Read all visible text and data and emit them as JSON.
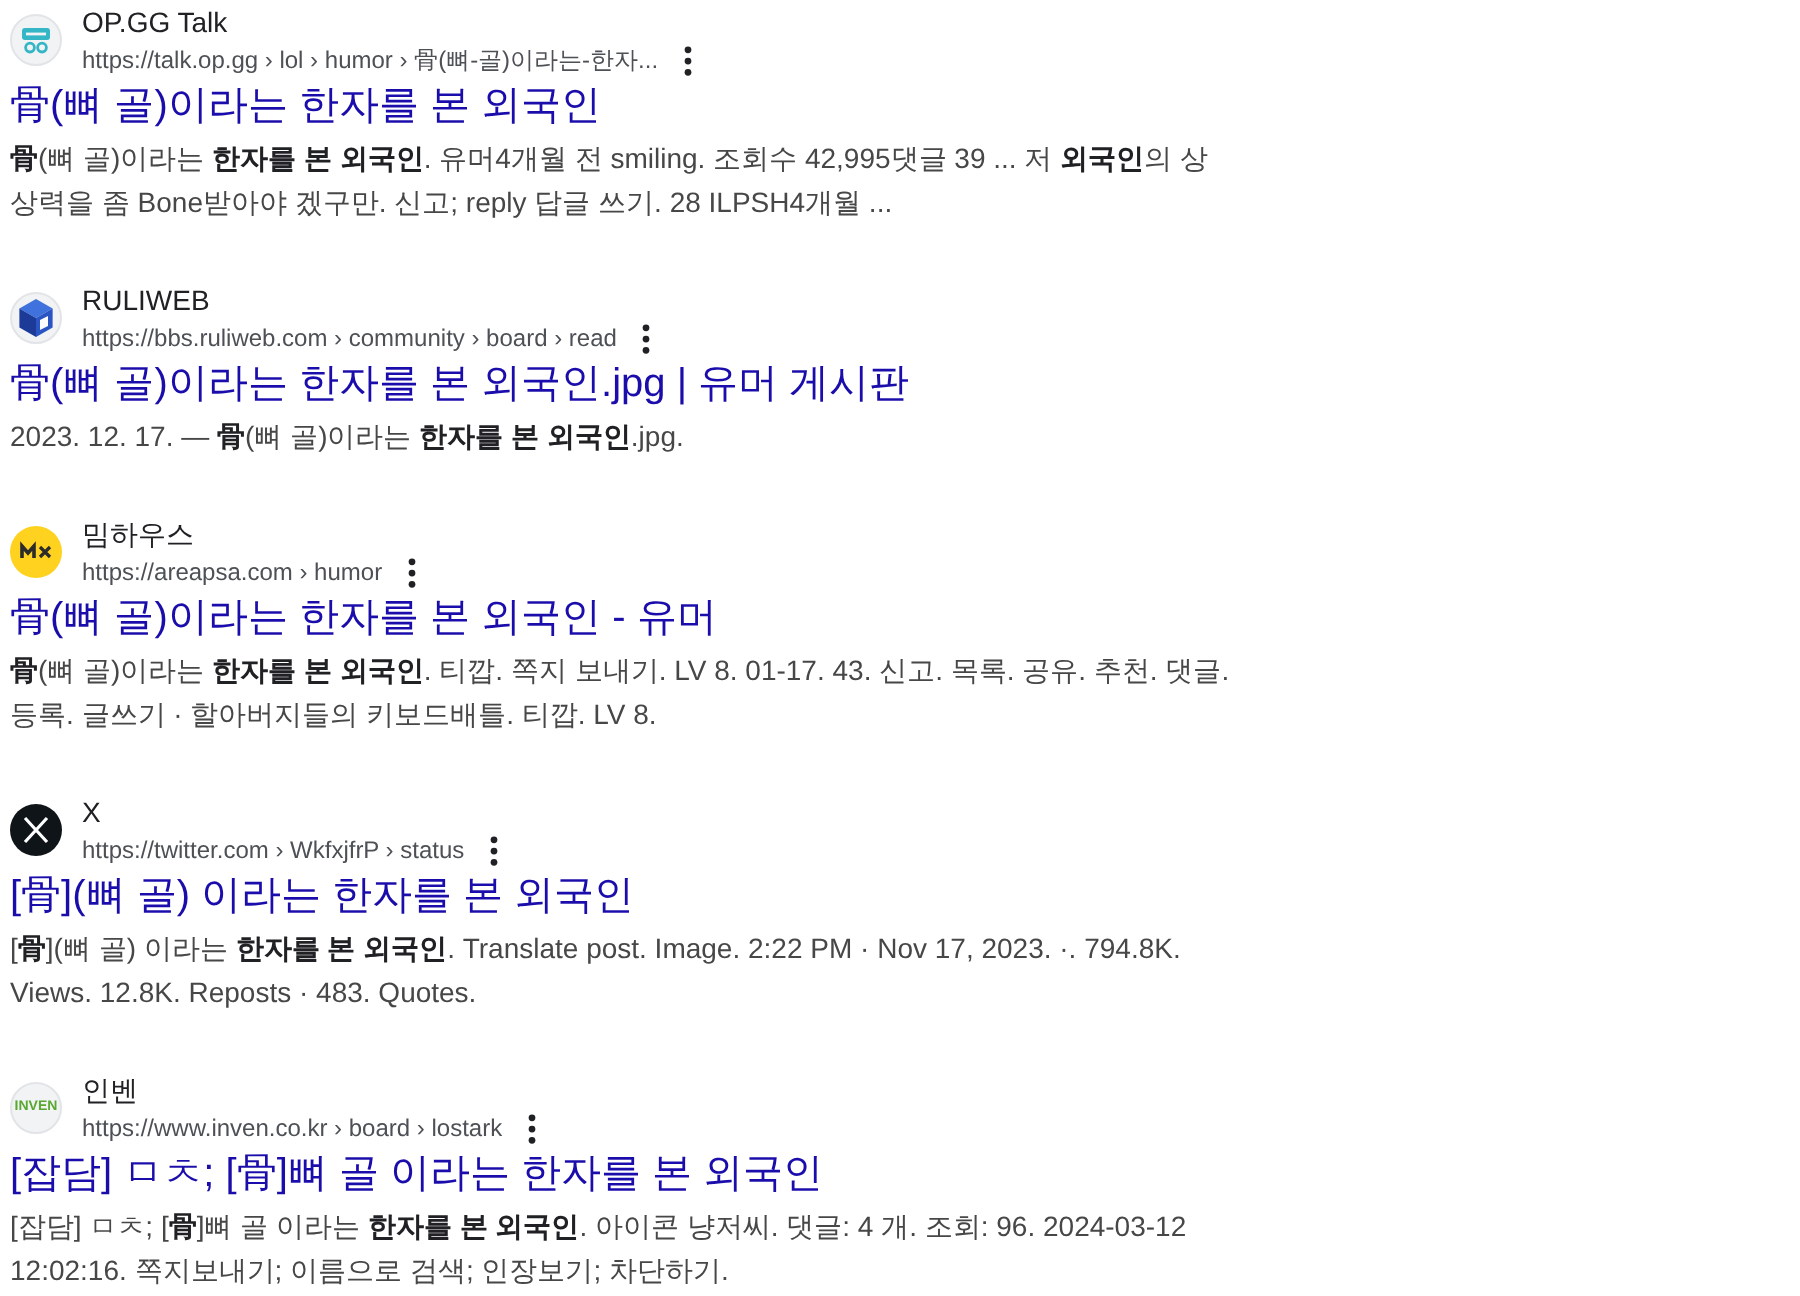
{
  "results": [
    {
      "site": "OP.GG Talk",
      "url": "https://talk.op.gg › lol › humor › 骨(뼈-골)이라는-한자...",
      "favicon": {
        "kind": "goggles"
      },
      "title": "骨(뼈 골)이라는 한자를 본 외국인",
      "snippet": "**骨**(뼈 골)이라는 **한자를 본 외국인**. 유머4개월 전 smiling. 조회수 42,995댓글 39 ... 저 **외국인**의 상상력을 좀 Bone받아야 겠구만. 신고; reply 답글 쓰기. 28 ILPSH4개월 ..."
    },
    {
      "site": "RULIWEB",
      "url": "https://bbs.ruliweb.com › community › board › read",
      "favicon": {
        "kind": "cube"
      },
      "title": "骨(뼈 골)이라는 한자를 본 외국인.jpg | 유머 게시판",
      "snippet": "2023. 12. 17. — **骨**(뼈 골)이라는 **한자를 본 외국인**.jpg."
    },
    {
      "site": "밈하우스",
      "url": "https://areapsa.com › humor",
      "favicon": {
        "kind": "round"
      },
      "title": "骨(뼈 골)이라는 한자를 본 외국인 - 유머",
      "snippet": "**骨**(뼈 골)이라는 **한자를 본 외국인**. 티깝. 쪽지 보내기. LV 8. 01-17. 43. 신고. 목록. 공유. 추천. 댓글. 등록. 글쓰기 · 할아버지들의 키보드배틀. 티깝. LV 8."
    },
    {
      "site": "X",
      "url": "https://twitter.com › WkfxjfrP › status",
      "favicon": {
        "kind": "xmark"
      },
      "title": "[骨](뼈 골) 이라는 한자를 본 외국인",
      "snippet": "[**骨**](뼈 골) 이라는 **한자를 본 외국인**. Translate post. Image. 2:22 PM · Nov 17, 2023. ·. 794.8K. Views. 12.8K. Reposts · 483. Quotes."
    },
    {
      "site": "인벤",
      "url": "https://www.inven.co.kr › board › lostark",
      "favicon": {
        "kind": "wordmark",
        "text": "INVEN"
      },
      "title": "[잡담] ㅁㅊ; [骨]뼈 골 이라는 한자를 본 외국인",
      "snippet": "[잡담] ㅁㅊ; [**骨**]뼈 골 이라는 **한자를 본 외국인**. 아이콘 냥저씨. 댓글: 4 개. 조회: 96. 2024-03-12 12:02:16. 쪽지보내기; 이름으로 검색; 인장보기; 차단하기."
    }
  ]
}
